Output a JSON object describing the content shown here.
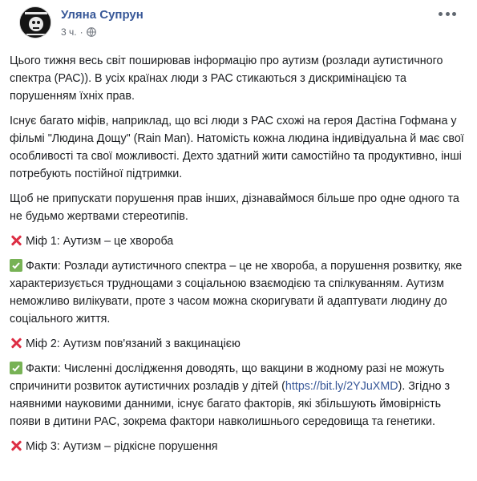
{
  "post": {
    "author": "Уляна Супрун",
    "time": "3 ч.",
    "paragraphs": [
      "Цього тижня весь світ поширював інформацію про аутизм (розлади аутистичного спектра (РАС)). В усіх країнах люди з РАС стикаються з дискримінацією та порушенням їхніх прав.",
      "Існує багато міфів, наприклад, що всі люди з РАС схожі на героя Дастіна Гофмана у фільмі \"Людина Дощу\" (Rain Man). Натомість кожна людина індивідуальна й має свої особливості та свої можливості. Дехто здатний жити самостійно та продуктивно, інші потребують постійної підтримки.",
      "Щоб не припускати порушення прав інших, дізнаваймося більше про одне одного та не будьмо жертвами стереотипів."
    ],
    "myth1": "Міф 1: Аутизм – це хвороба",
    "fact1": "Факти: Розлади аутистичного спектра – це не хвороба, а порушення розвитку, яке характеризується труднощами з соціальною взаємодією та спілкуванням. Аутизм неможливо вилікувати, проте з часом можна скоригувати й адаптувати людину до соціального життя.",
    "myth2": "Міф 2: Аутизм пов'язаний з вакцинацією",
    "fact2_before": "Факти: Численні дослідження доводять, що вакцини в жодному разі не можуть спричинити розвиток аутистичних розладів у дітей (",
    "fact2_link": "https://bit.ly/2YJuXMD",
    "fact2_after": "). Згідно з наявними науковими данними, існує багато факторів, які збільшують ймовірність появи в дитини РАС, зокрема фактори навколишнього середовища та генетики.",
    "myth3": "Міф 3: Аутизм – рідкісне порушення"
  },
  "icons": {
    "cross": "cross-mark-icon",
    "check": "check-mark-icon",
    "globe": "globe-icon",
    "more": "more-options-icon"
  },
  "colors": {
    "author": "#385898",
    "cross": "#dd2e44",
    "check": "#77b255"
  }
}
